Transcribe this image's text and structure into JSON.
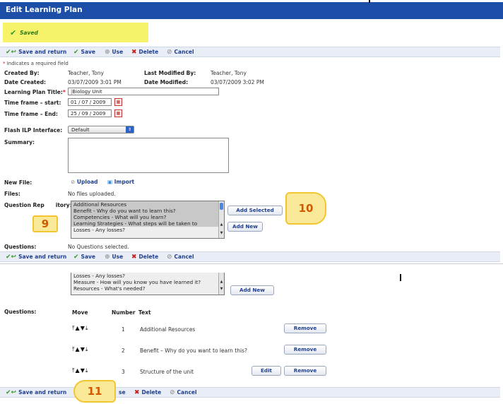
{
  "window": {
    "title": "Edit Learning Plan"
  },
  "status": {
    "message": "Saved"
  },
  "toolbar": {
    "save_and_return": "Save and return",
    "save": "Save",
    "use": "Use",
    "delete": "Delete",
    "cancel": "Cancel"
  },
  "required_note": {
    "star": "*",
    "text": "Indicates a required field"
  },
  "fields": {
    "created_by": {
      "label": "Created By:",
      "value": "Teacher, Tony"
    },
    "last_modified_by": {
      "label": "Last Modified By:",
      "value": "Teacher, Tony"
    },
    "date_created": {
      "label": "Date Created:",
      "value": "03/07/2009 3:01 PM"
    },
    "date_modified": {
      "label": "Date Modified:",
      "value": "03/07/2009 3:02 PM"
    },
    "title": {
      "label": "Learning Plan Title:",
      "star": "*",
      "value": "Biology Unit"
    },
    "timeframe_start": {
      "label": "Time frame – start:",
      "day": "01",
      "month": "07",
      "year": "2009"
    },
    "timeframe_end": {
      "label": "Time frame – End:",
      "day": "25",
      "month": "09",
      "year": "2009"
    },
    "flash_ilp": {
      "label": "Flash ILP Interface:",
      "value": "Default"
    },
    "summary": {
      "label": "Summary:"
    },
    "new_file": {
      "label": "New File:",
      "upload": "Upload",
      "import": "Import"
    },
    "files": {
      "label": "Files:",
      "value": "No files uploaded."
    },
    "question_repository": {
      "label_a": "Question Rep",
      "label_b": "itory:"
    },
    "questions": {
      "label": "Questions:",
      "value": "No Questions selected."
    }
  },
  "repository_options": [
    "Additional Resources",
    "Benefit - Why do you want to learn this?",
    "Competencies - What will you learn?",
    "Learning Strategies - What steps will be taken to",
    "Losses - Any losses?"
  ],
  "repository_buttons": {
    "add_selected": "Add Selected",
    "add_new": "Add New"
  },
  "callouts": {
    "c9": "9",
    "c10": "10",
    "c11": "11"
  },
  "panel2": {
    "repository_options": [
      "Losses - Any losses?",
      "Measure - How will you know you have learned it?",
      "Resources - What's needed?"
    ],
    "add_new": "Add New",
    "questions_label": "Questions:",
    "columns": {
      "move": "Move",
      "number": "Number",
      "text": "Text"
    },
    "rows": [
      {
        "number": "1",
        "text": "Additional Resources",
        "edit": false
      },
      {
        "number": "2",
        "text": "Benefit – Why do you want to learn this?",
        "edit": false
      },
      {
        "number": "3",
        "text": "Structure of the unit",
        "edit": true
      }
    ],
    "move_arrows": "⤒▲▼⤓",
    "edit_label": "Edit",
    "remove_label": "Remove",
    "toolbar": {
      "save_and_return": "Save and return",
      "use_fragment": "se",
      "delete": "Delete",
      "cancel": "Cancel"
    }
  },
  "colors": {
    "titlebar": "#1e4fa8",
    "saved_highlight": "#f6f36a",
    "link": "#1f3f8f",
    "callout_fill": "#fbe99a",
    "callout_text": "#d15a00"
  }
}
